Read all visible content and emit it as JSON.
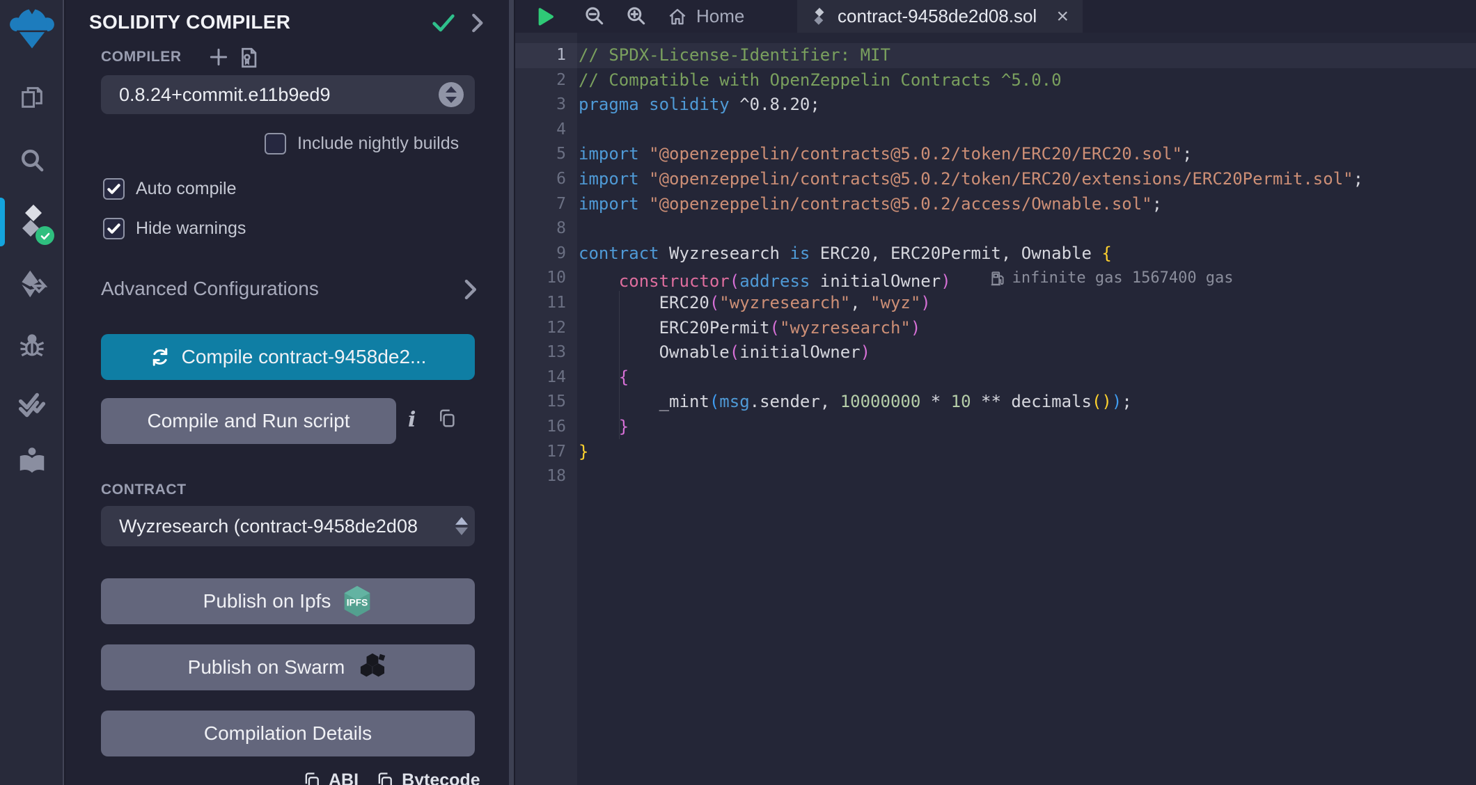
{
  "colors": {
    "compile_button": "#0f7ea4",
    "secondary_button": "#63667c",
    "active_rail_indicator": "#14a4dd",
    "success_green": "#2fc08c",
    "play_green": "#2fca77",
    "panel_bg": "#212232",
    "editor_bg": "#242637"
  },
  "rail": {
    "icons": [
      "remix-logo",
      "file-explorer",
      "search",
      "solidity-compiler-active",
      "deploy-and-run",
      "debugger",
      "static-analysis",
      "learneth"
    ]
  },
  "sidebar": {
    "title": "SOLIDITY COMPILER",
    "compiler_label": "COMPILER",
    "version_value": "0.8.24+commit.e11b9ed9",
    "include_nightly_label": "Include nightly builds",
    "auto_compile_label": "Auto compile",
    "hide_warnings_label": "Hide warnings",
    "advanced_label": "Advanced Configurations",
    "compile_button_label": "Compile contract-9458de2...",
    "compile_run_button_label": "Compile and Run script",
    "contract_label": "CONTRACT",
    "contract_value": "Wyzresearch (contract-9458de2d08",
    "publish_ipfs_label": "Publish on Ipfs",
    "ipfs_badge_text": "IPFS",
    "publish_swarm_label": "Publish on Swarm",
    "compilation_details_label": "Compilation Details",
    "abi_label": "ABI",
    "bytecode_label": "Bytecode"
  },
  "editor": {
    "tabs": [
      {
        "label": "Home"
      },
      {
        "label": "contract-9458de2d08.sol"
      }
    ],
    "gas_annotation": "infinite gas 1567400 gas",
    "lines": [
      {
        "n": 1,
        "hl": true,
        "tokens": [
          {
            "c": "cm",
            "t": "// SPDX-License-Identifier: MIT"
          }
        ]
      },
      {
        "n": 2,
        "tokens": [
          {
            "c": "cm",
            "t": "// Compatible with OpenZeppelin Contracts ^5.0.0"
          }
        ]
      },
      {
        "n": 3,
        "tokens": [
          {
            "c": "kw",
            "t": "pragma"
          },
          {
            "c": "txt",
            "t": " "
          },
          {
            "c": "kw",
            "t": "solidity"
          },
          {
            "c": "txt",
            "t": " ^0.8.20;"
          }
        ]
      },
      {
        "n": 4,
        "tokens": []
      },
      {
        "n": 5,
        "tokens": [
          {
            "c": "kw",
            "t": "import"
          },
          {
            "c": "txt",
            "t": " "
          },
          {
            "c": "str",
            "t": "\"@openzeppelin/contracts@5.0.2/token/ERC20/ERC20.sol\""
          },
          {
            "c": "txt",
            "t": ";"
          }
        ]
      },
      {
        "n": 6,
        "tokens": [
          {
            "c": "kw",
            "t": "import"
          },
          {
            "c": "txt",
            "t": " "
          },
          {
            "c": "str",
            "t": "\"@openzeppelin/contracts@5.0.2/token/ERC20/extensions/ERC20Permit.sol\""
          },
          {
            "c": "txt",
            "t": ";"
          }
        ]
      },
      {
        "n": 7,
        "tokens": [
          {
            "c": "kw",
            "t": "import"
          },
          {
            "c": "txt",
            "t": " "
          },
          {
            "c": "str",
            "t": "\"@openzeppelin/contracts@5.0.2/access/Ownable.sol\""
          },
          {
            "c": "txt",
            "t": ";"
          }
        ]
      },
      {
        "n": 8,
        "tokens": []
      },
      {
        "n": 9,
        "tokens": [
          {
            "c": "kw",
            "t": "contract"
          },
          {
            "c": "txt",
            "t": " Wyzresearch "
          },
          {
            "c": "kw",
            "t": "is"
          },
          {
            "c": "txt",
            "t": " ERC20, ERC20Permit, Ownable "
          },
          {
            "c": "b1",
            "t": "{"
          }
        ]
      },
      {
        "n": 10,
        "gas": true,
        "tokens": [
          {
            "c": "txt",
            "t": "    "
          },
          {
            "c": "ctor",
            "t": "constructor"
          },
          {
            "c": "b2",
            "t": "("
          },
          {
            "c": "kw",
            "t": "address"
          },
          {
            "c": "txt",
            "t": " initialOwner"
          },
          {
            "c": "b2",
            "t": ")"
          }
        ]
      },
      {
        "n": 11,
        "tokens": [
          {
            "c": "txt",
            "t": "        ERC20"
          },
          {
            "c": "b2",
            "t": "("
          },
          {
            "c": "str",
            "t": "\"wyzresearch\""
          },
          {
            "c": "txt",
            "t": ", "
          },
          {
            "c": "str",
            "t": "\"wyz\""
          },
          {
            "c": "b2",
            "t": ")"
          }
        ]
      },
      {
        "n": 12,
        "tokens": [
          {
            "c": "txt",
            "t": "        ERC20Permit"
          },
          {
            "c": "b2",
            "t": "("
          },
          {
            "c": "str",
            "t": "\"wyzresearch\""
          },
          {
            "c": "b2",
            "t": ")"
          }
        ]
      },
      {
        "n": 13,
        "tokens": [
          {
            "c": "txt",
            "t": "        Ownable"
          },
          {
            "c": "b2",
            "t": "("
          },
          {
            "c": "txt",
            "t": "initialOwner"
          },
          {
            "c": "b2",
            "t": ")"
          }
        ]
      },
      {
        "n": 14,
        "tokens": [
          {
            "c": "txt",
            "t": "    "
          },
          {
            "c": "b2",
            "t": "{"
          }
        ]
      },
      {
        "n": 15,
        "tokens": [
          {
            "c": "txt",
            "t": "        _mint"
          },
          {
            "c": "b3",
            "t": "("
          },
          {
            "c": "kw",
            "t": "msg"
          },
          {
            "c": "txt",
            "t": ".sender, "
          },
          {
            "c": "num",
            "t": "10000000"
          },
          {
            "c": "txt",
            "t": " * "
          },
          {
            "c": "num",
            "t": "10"
          },
          {
            "c": "txt",
            "t": " ** decimals"
          },
          {
            "c": "b1",
            "t": "()"
          },
          {
            "c": "b3",
            "t": ")"
          },
          {
            "c": "txt",
            "t": ";"
          }
        ]
      },
      {
        "n": 16,
        "tokens": [
          {
            "c": "txt",
            "t": "    "
          },
          {
            "c": "b2",
            "t": "}"
          }
        ]
      },
      {
        "n": 17,
        "tokens": [
          {
            "c": "b1",
            "t": "}"
          }
        ]
      },
      {
        "n": 18,
        "tokens": []
      }
    ]
  }
}
